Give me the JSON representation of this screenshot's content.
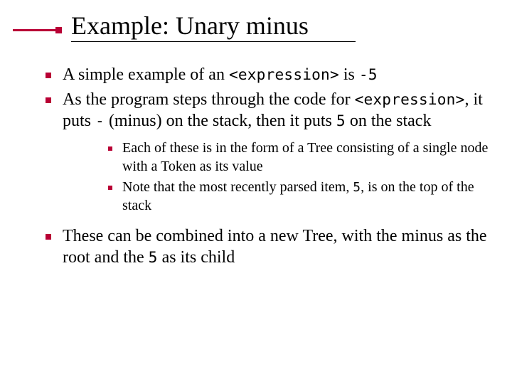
{
  "title": "Example: Unary minus",
  "bullets": {
    "b1_a": "A simple example of an ",
    "b1_code1": "<expression>",
    "b1_b": " is ",
    "b1_code2": "-5",
    "b2_a": "As the program steps through the code for ",
    "b2_code1": "<expression>",
    "b2_b": ", it puts ",
    "b2_code2": "-",
    "b2_c": " (minus) on the stack, then it puts ",
    "b2_code3": "5",
    "b2_d": " on the stack",
    "sub1": "Each of these is in the form of a Tree consisting of a single node with a Token as its value",
    "sub2_a": "Note that the most recently parsed item, ",
    "sub2_code": "5",
    "sub2_b": ", is on the top of the stack",
    "b3_a": "These can be combined into a new Tree, with the minus as the root and the ",
    "b3_code": "5",
    "b3_b": " as its child"
  }
}
